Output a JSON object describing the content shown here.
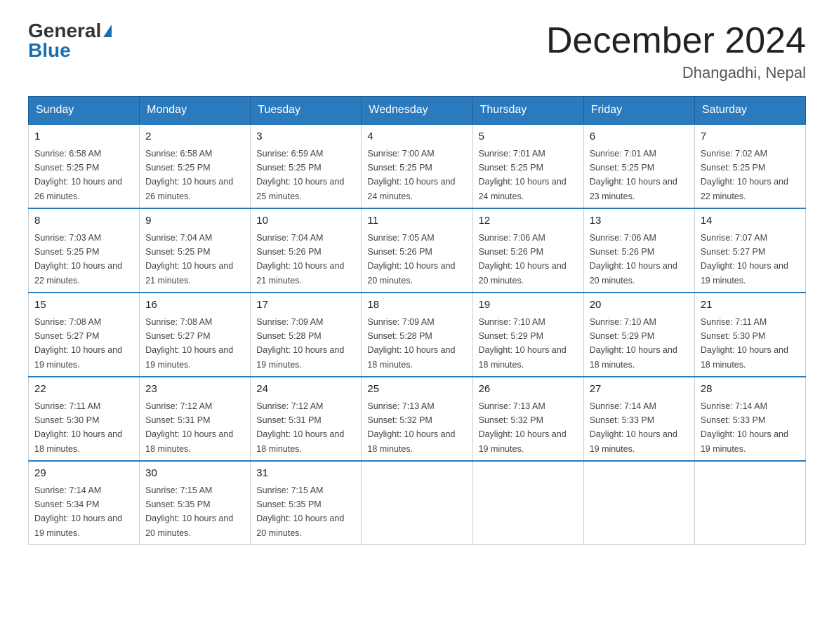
{
  "header": {
    "logo_general": "General",
    "logo_blue": "Blue",
    "title": "December 2024",
    "subtitle": "Dhangadhi, Nepal"
  },
  "days_of_week": [
    "Sunday",
    "Monday",
    "Tuesday",
    "Wednesday",
    "Thursday",
    "Friday",
    "Saturday"
  ],
  "weeks": [
    [
      {
        "day": 1,
        "sunrise": "6:58 AM",
        "sunset": "5:25 PM",
        "daylight": "10 hours and 26 minutes."
      },
      {
        "day": 2,
        "sunrise": "6:58 AM",
        "sunset": "5:25 PM",
        "daylight": "10 hours and 26 minutes."
      },
      {
        "day": 3,
        "sunrise": "6:59 AM",
        "sunset": "5:25 PM",
        "daylight": "10 hours and 25 minutes."
      },
      {
        "day": 4,
        "sunrise": "7:00 AM",
        "sunset": "5:25 PM",
        "daylight": "10 hours and 24 minutes."
      },
      {
        "day": 5,
        "sunrise": "7:01 AM",
        "sunset": "5:25 PM",
        "daylight": "10 hours and 24 minutes."
      },
      {
        "day": 6,
        "sunrise": "7:01 AM",
        "sunset": "5:25 PM",
        "daylight": "10 hours and 23 minutes."
      },
      {
        "day": 7,
        "sunrise": "7:02 AM",
        "sunset": "5:25 PM",
        "daylight": "10 hours and 22 minutes."
      }
    ],
    [
      {
        "day": 8,
        "sunrise": "7:03 AM",
        "sunset": "5:25 PM",
        "daylight": "10 hours and 22 minutes."
      },
      {
        "day": 9,
        "sunrise": "7:04 AM",
        "sunset": "5:25 PM",
        "daylight": "10 hours and 21 minutes."
      },
      {
        "day": 10,
        "sunrise": "7:04 AM",
        "sunset": "5:26 PM",
        "daylight": "10 hours and 21 minutes."
      },
      {
        "day": 11,
        "sunrise": "7:05 AM",
        "sunset": "5:26 PM",
        "daylight": "10 hours and 20 minutes."
      },
      {
        "day": 12,
        "sunrise": "7:06 AM",
        "sunset": "5:26 PM",
        "daylight": "10 hours and 20 minutes."
      },
      {
        "day": 13,
        "sunrise": "7:06 AM",
        "sunset": "5:26 PM",
        "daylight": "10 hours and 20 minutes."
      },
      {
        "day": 14,
        "sunrise": "7:07 AM",
        "sunset": "5:27 PM",
        "daylight": "10 hours and 19 minutes."
      }
    ],
    [
      {
        "day": 15,
        "sunrise": "7:08 AM",
        "sunset": "5:27 PM",
        "daylight": "10 hours and 19 minutes."
      },
      {
        "day": 16,
        "sunrise": "7:08 AM",
        "sunset": "5:27 PM",
        "daylight": "10 hours and 19 minutes."
      },
      {
        "day": 17,
        "sunrise": "7:09 AM",
        "sunset": "5:28 PM",
        "daylight": "10 hours and 19 minutes."
      },
      {
        "day": 18,
        "sunrise": "7:09 AM",
        "sunset": "5:28 PM",
        "daylight": "10 hours and 18 minutes."
      },
      {
        "day": 19,
        "sunrise": "7:10 AM",
        "sunset": "5:29 PM",
        "daylight": "10 hours and 18 minutes."
      },
      {
        "day": 20,
        "sunrise": "7:10 AM",
        "sunset": "5:29 PM",
        "daylight": "10 hours and 18 minutes."
      },
      {
        "day": 21,
        "sunrise": "7:11 AM",
        "sunset": "5:30 PM",
        "daylight": "10 hours and 18 minutes."
      }
    ],
    [
      {
        "day": 22,
        "sunrise": "7:11 AM",
        "sunset": "5:30 PM",
        "daylight": "10 hours and 18 minutes."
      },
      {
        "day": 23,
        "sunrise": "7:12 AM",
        "sunset": "5:31 PM",
        "daylight": "10 hours and 18 minutes."
      },
      {
        "day": 24,
        "sunrise": "7:12 AM",
        "sunset": "5:31 PM",
        "daylight": "10 hours and 18 minutes."
      },
      {
        "day": 25,
        "sunrise": "7:13 AM",
        "sunset": "5:32 PM",
        "daylight": "10 hours and 18 minutes."
      },
      {
        "day": 26,
        "sunrise": "7:13 AM",
        "sunset": "5:32 PM",
        "daylight": "10 hours and 19 minutes."
      },
      {
        "day": 27,
        "sunrise": "7:14 AM",
        "sunset": "5:33 PM",
        "daylight": "10 hours and 19 minutes."
      },
      {
        "day": 28,
        "sunrise": "7:14 AM",
        "sunset": "5:33 PM",
        "daylight": "10 hours and 19 minutes."
      }
    ],
    [
      {
        "day": 29,
        "sunrise": "7:14 AM",
        "sunset": "5:34 PM",
        "daylight": "10 hours and 19 minutes."
      },
      {
        "day": 30,
        "sunrise": "7:15 AM",
        "sunset": "5:35 PM",
        "daylight": "10 hours and 20 minutes."
      },
      {
        "day": 31,
        "sunrise": "7:15 AM",
        "sunset": "5:35 PM",
        "daylight": "10 hours and 20 minutes."
      },
      null,
      null,
      null,
      null
    ]
  ]
}
